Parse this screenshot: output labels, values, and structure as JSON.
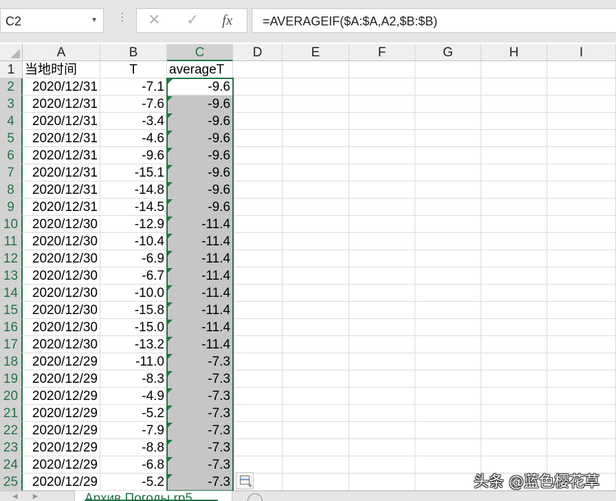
{
  "name_box": "C2",
  "formula_bar": {
    "cancel_icon": "✕",
    "enter_icon": "✓",
    "fx_icon": "fx",
    "formula": "=AVERAGEIF($A:$A,A2,$B:$B)"
  },
  "columns": [
    "A",
    "B",
    "C",
    "D",
    "E",
    "F",
    "G",
    "H",
    "I"
  ],
  "headers": {
    "a": "当地时间",
    "b": "T",
    "c": "averageT"
  },
  "rows": [
    {
      "n": "2",
      "a": "2020/12/31",
      "b": "-7.1",
      "c": "-9.6"
    },
    {
      "n": "3",
      "a": "2020/12/31",
      "b": "-7.6",
      "c": "-9.6"
    },
    {
      "n": "4",
      "a": "2020/12/31",
      "b": "-3.4",
      "c": "-9.6"
    },
    {
      "n": "5",
      "a": "2020/12/31",
      "b": "-4.6",
      "c": "-9.6"
    },
    {
      "n": "6",
      "a": "2020/12/31",
      "b": "-9.6",
      "c": "-9.6"
    },
    {
      "n": "7",
      "a": "2020/12/31",
      "b": "-15.1",
      "c": "-9.6"
    },
    {
      "n": "8",
      "a": "2020/12/31",
      "b": "-14.8",
      "c": "-9.6"
    },
    {
      "n": "9",
      "a": "2020/12/31",
      "b": "-14.5",
      "c": "-9.6"
    },
    {
      "n": "10",
      "a": "2020/12/30",
      "b": "-12.9",
      "c": "-11.4"
    },
    {
      "n": "11",
      "a": "2020/12/30",
      "b": "-10.4",
      "c": "-11.4"
    },
    {
      "n": "12",
      "a": "2020/12/30",
      "b": "-6.9",
      "c": "-11.4"
    },
    {
      "n": "13",
      "a": "2020/12/30",
      "b": "-6.7",
      "c": "-11.4"
    },
    {
      "n": "14",
      "a": "2020/12/30",
      "b": "-10.0",
      "c": "-11.4"
    },
    {
      "n": "15",
      "a": "2020/12/30",
      "b": "-15.8",
      "c": "-11.4"
    },
    {
      "n": "16",
      "a": "2020/12/30",
      "b": "-15.0",
      "c": "-11.4"
    },
    {
      "n": "17",
      "a": "2020/12/30",
      "b": "-13.2",
      "c": "-11.4"
    },
    {
      "n": "18",
      "a": "2020/12/29",
      "b": "-11.0",
      "c": "-7.3"
    },
    {
      "n": "19",
      "a": "2020/12/29",
      "b": "-8.3",
      "c": "-7.3"
    },
    {
      "n": "20",
      "a": "2020/12/29",
      "b": "-4.9",
      "c": "-7.3"
    },
    {
      "n": "21",
      "a": "2020/12/29",
      "b": "-5.2",
      "c": "-7.3"
    },
    {
      "n": "22",
      "a": "2020/12/29",
      "b": "-7.9",
      "c": "-7.3"
    },
    {
      "n": "23",
      "a": "2020/12/29",
      "b": "-8.8",
      "c": "-7.3"
    },
    {
      "n": "24",
      "a": "2020/12/29",
      "b": "-6.8",
      "c": "-7.3"
    },
    {
      "n": "25",
      "a": "2020/12/29",
      "b": "-5.2",
      "c": "-7.3"
    }
  ],
  "sheet_tab": "Архив Погоды rp5",
  "watermark": "头条 @蓝色樱花草",
  "colors": {
    "accent": "#217346",
    "selection_fill": "#c6c6c6",
    "error_triangle": "#1f7a3f"
  }
}
